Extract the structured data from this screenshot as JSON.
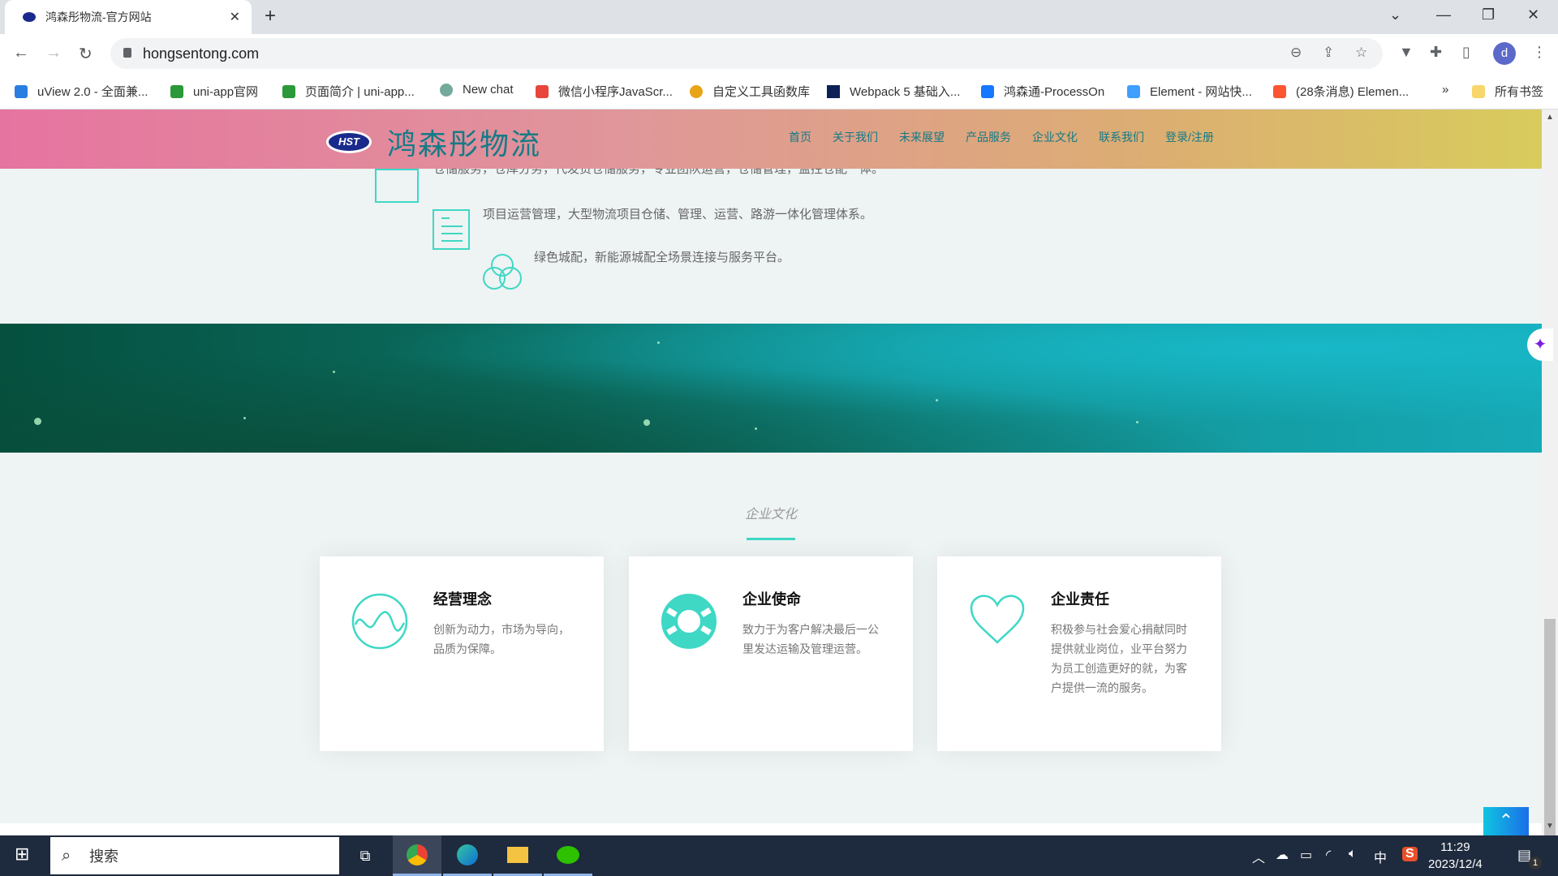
{
  "browser": {
    "tab_title": "鸿森彤物流-官方网站",
    "url": "hongsentong.com",
    "profile_initial": "d",
    "bookmarks": [
      "uView 2.0 - 全面兼...",
      "uni-app官网",
      "页面简介 | uni-app...",
      "New chat",
      "微信小程序JavaScr...",
      "自定义工具函数库",
      "Webpack 5 基础入...",
      "鸿森通-ProcessOn",
      "Element - 网站快...",
      "(28条消息) Elemen..."
    ],
    "bookmark_colors": [
      "#2a7de1",
      "#2b9939",
      "#2b9939",
      "#74aa9c",
      "#e8453c",
      "#e8a317",
      "#0d2157",
      "#1677ff",
      "#409eff",
      "#fc5531"
    ],
    "more_bookmarks": "»",
    "all_bookmarks": "所有书签"
  },
  "site": {
    "brand": "鸿森彤物流",
    "logo_text": "HST",
    "nav": [
      "首页",
      "关于我们",
      "未来展望",
      "产品服务",
      "企业文化",
      "联系我们",
      "登录/注册"
    ],
    "features": [
      "仓储服务，仓库分务，代发货仓储服务，专业团队运营，仓储管理，监控仓配一体。",
      "项目运营管理，大型物流项目仓储、管理、运营、路游一体化管理体系。",
      "绿色城配，新能源城配全场景连接与服务平台。"
    ],
    "culture_title": "企业文化",
    "cards": [
      {
        "title": "经营理念",
        "text": "创新为动力，市场为导向，品质为保障。",
        "icon": "wave-circle-icon"
      },
      {
        "title": "企业使命",
        "text": "致力于为客户解决最后一公里发达运输及管理运营。",
        "icon": "lifebuoy-icon"
      },
      {
        "title": "企业责任",
        "text": "积极参与社会爱心捐献同时提供就业岗位，业平台努力为员工创造更好的就，为客户提供一流的服务。",
        "icon": "heart-icon"
      }
    ],
    "accent": "#3ed8c5"
  },
  "taskbar": {
    "search_placeholder": "搜索",
    "ime": "中",
    "time": "11:29",
    "date": "2023/12/4",
    "notifications": "1"
  }
}
